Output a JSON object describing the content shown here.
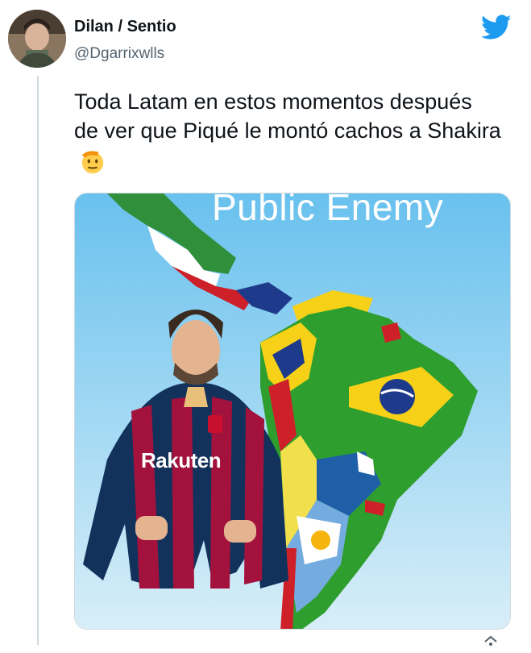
{
  "tweet": {
    "display_name": "Dilan / Sentio",
    "handle": "@Dgarrixwlls",
    "text": "Toda Latam en estos momentos después de ver que Piqué le montó cachos a Shakira",
    "emoji_icon": "saluting-face-icon"
  },
  "media": {
    "title": "Public Enemy",
    "jersey_text": "Rakuten"
  },
  "icons": {
    "platform": "twitter-bird-icon",
    "share": "share-icon"
  },
  "colors": {
    "twitter_blue": "#1d9bf0",
    "handle_gray": "#536471",
    "ocean": "#a9dbf3",
    "thread_line": "#cfd9de"
  }
}
